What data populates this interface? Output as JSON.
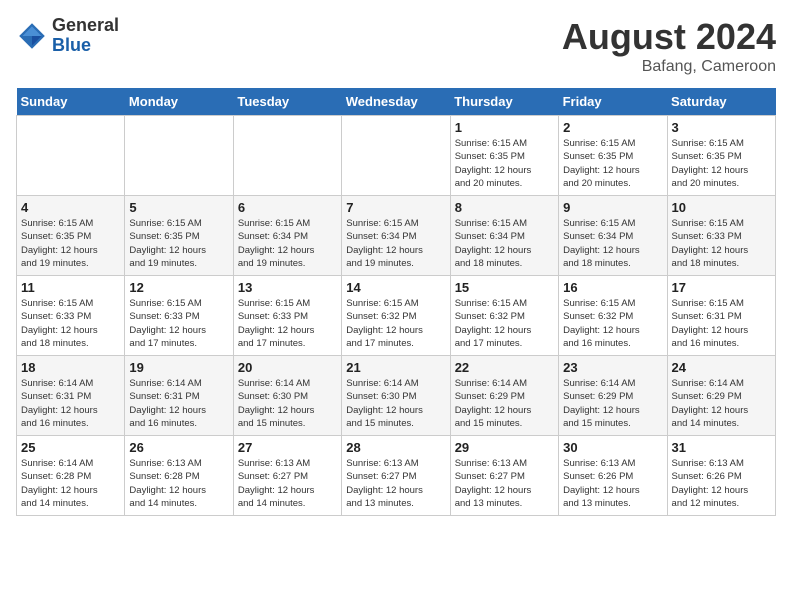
{
  "header": {
    "logo_general": "General",
    "logo_blue": "Blue",
    "month_year": "August 2024",
    "location": "Bafang, Cameroon"
  },
  "days_of_week": [
    "Sunday",
    "Monday",
    "Tuesday",
    "Wednesday",
    "Thursday",
    "Friday",
    "Saturday"
  ],
  "weeks": [
    [
      {
        "day": "",
        "info": ""
      },
      {
        "day": "",
        "info": ""
      },
      {
        "day": "",
        "info": ""
      },
      {
        "day": "",
        "info": ""
      },
      {
        "day": "1",
        "info": "Sunrise: 6:15 AM\nSunset: 6:35 PM\nDaylight: 12 hours\nand 20 minutes."
      },
      {
        "day": "2",
        "info": "Sunrise: 6:15 AM\nSunset: 6:35 PM\nDaylight: 12 hours\nand 20 minutes."
      },
      {
        "day": "3",
        "info": "Sunrise: 6:15 AM\nSunset: 6:35 PM\nDaylight: 12 hours\nand 20 minutes."
      }
    ],
    [
      {
        "day": "4",
        "info": "Sunrise: 6:15 AM\nSunset: 6:35 PM\nDaylight: 12 hours\nand 19 minutes."
      },
      {
        "day": "5",
        "info": "Sunrise: 6:15 AM\nSunset: 6:35 PM\nDaylight: 12 hours\nand 19 minutes."
      },
      {
        "day": "6",
        "info": "Sunrise: 6:15 AM\nSunset: 6:34 PM\nDaylight: 12 hours\nand 19 minutes."
      },
      {
        "day": "7",
        "info": "Sunrise: 6:15 AM\nSunset: 6:34 PM\nDaylight: 12 hours\nand 19 minutes."
      },
      {
        "day": "8",
        "info": "Sunrise: 6:15 AM\nSunset: 6:34 PM\nDaylight: 12 hours\nand 18 minutes."
      },
      {
        "day": "9",
        "info": "Sunrise: 6:15 AM\nSunset: 6:34 PM\nDaylight: 12 hours\nand 18 minutes."
      },
      {
        "day": "10",
        "info": "Sunrise: 6:15 AM\nSunset: 6:33 PM\nDaylight: 12 hours\nand 18 minutes."
      }
    ],
    [
      {
        "day": "11",
        "info": "Sunrise: 6:15 AM\nSunset: 6:33 PM\nDaylight: 12 hours\nand 18 minutes."
      },
      {
        "day": "12",
        "info": "Sunrise: 6:15 AM\nSunset: 6:33 PM\nDaylight: 12 hours\nand 17 minutes."
      },
      {
        "day": "13",
        "info": "Sunrise: 6:15 AM\nSunset: 6:33 PM\nDaylight: 12 hours\nand 17 minutes."
      },
      {
        "day": "14",
        "info": "Sunrise: 6:15 AM\nSunset: 6:32 PM\nDaylight: 12 hours\nand 17 minutes."
      },
      {
        "day": "15",
        "info": "Sunrise: 6:15 AM\nSunset: 6:32 PM\nDaylight: 12 hours\nand 17 minutes."
      },
      {
        "day": "16",
        "info": "Sunrise: 6:15 AM\nSunset: 6:32 PM\nDaylight: 12 hours\nand 16 minutes."
      },
      {
        "day": "17",
        "info": "Sunrise: 6:15 AM\nSunset: 6:31 PM\nDaylight: 12 hours\nand 16 minutes."
      }
    ],
    [
      {
        "day": "18",
        "info": "Sunrise: 6:14 AM\nSunset: 6:31 PM\nDaylight: 12 hours\nand 16 minutes."
      },
      {
        "day": "19",
        "info": "Sunrise: 6:14 AM\nSunset: 6:31 PM\nDaylight: 12 hours\nand 16 minutes."
      },
      {
        "day": "20",
        "info": "Sunrise: 6:14 AM\nSunset: 6:30 PM\nDaylight: 12 hours\nand 15 minutes."
      },
      {
        "day": "21",
        "info": "Sunrise: 6:14 AM\nSunset: 6:30 PM\nDaylight: 12 hours\nand 15 minutes."
      },
      {
        "day": "22",
        "info": "Sunrise: 6:14 AM\nSunset: 6:29 PM\nDaylight: 12 hours\nand 15 minutes."
      },
      {
        "day": "23",
        "info": "Sunrise: 6:14 AM\nSunset: 6:29 PM\nDaylight: 12 hours\nand 15 minutes."
      },
      {
        "day": "24",
        "info": "Sunrise: 6:14 AM\nSunset: 6:29 PM\nDaylight: 12 hours\nand 14 minutes."
      }
    ],
    [
      {
        "day": "25",
        "info": "Sunrise: 6:14 AM\nSunset: 6:28 PM\nDaylight: 12 hours\nand 14 minutes."
      },
      {
        "day": "26",
        "info": "Sunrise: 6:13 AM\nSunset: 6:28 PM\nDaylight: 12 hours\nand 14 minutes."
      },
      {
        "day": "27",
        "info": "Sunrise: 6:13 AM\nSunset: 6:27 PM\nDaylight: 12 hours\nand 14 minutes."
      },
      {
        "day": "28",
        "info": "Sunrise: 6:13 AM\nSunset: 6:27 PM\nDaylight: 12 hours\nand 13 minutes."
      },
      {
        "day": "29",
        "info": "Sunrise: 6:13 AM\nSunset: 6:27 PM\nDaylight: 12 hours\nand 13 minutes."
      },
      {
        "day": "30",
        "info": "Sunrise: 6:13 AM\nSunset: 6:26 PM\nDaylight: 12 hours\nand 13 minutes."
      },
      {
        "day": "31",
        "info": "Sunrise: 6:13 AM\nSunset: 6:26 PM\nDaylight: 12 hours\nand 12 minutes."
      }
    ]
  ]
}
